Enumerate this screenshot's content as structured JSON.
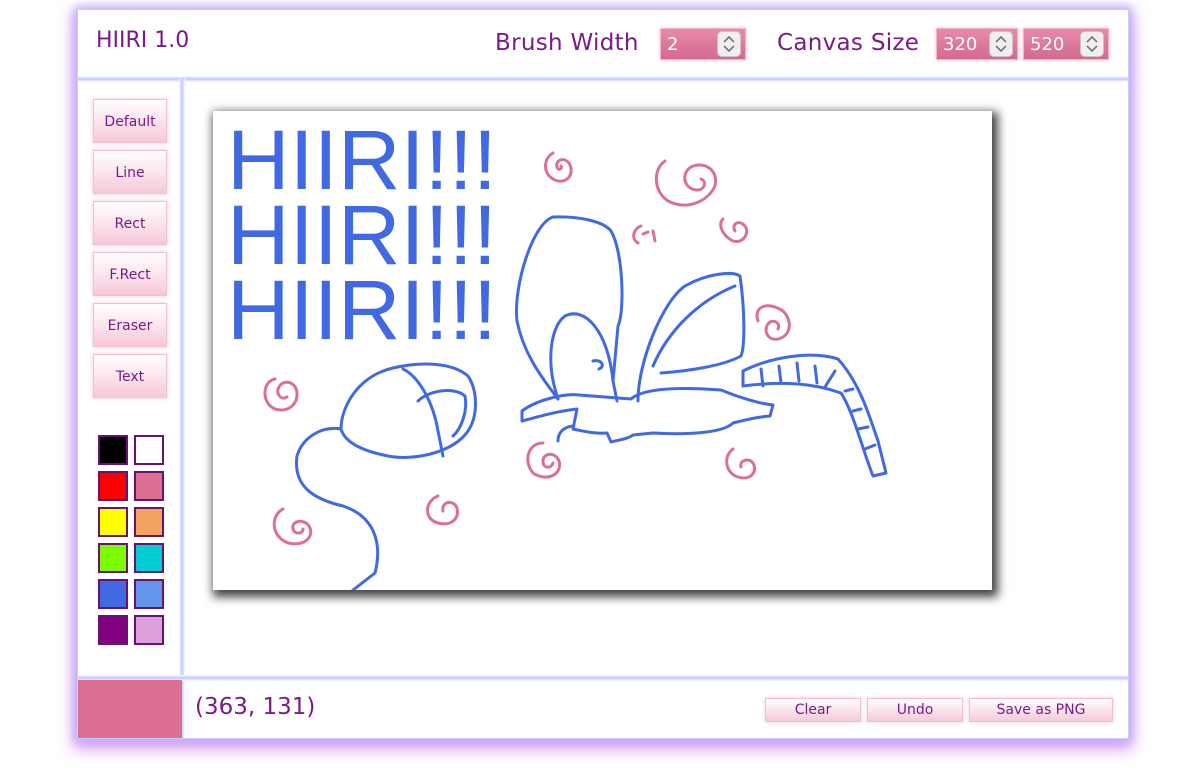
{
  "app": {
    "title": "HIIRI 1.0"
  },
  "toolbar": {
    "brush_width_label": "Brush Width",
    "brush_width_value": "2",
    "canvas_size_label": "Canvas Size",
    "canvas_width_value": "320",
    "canvas_height_value": "520"
  },
  "tools": [
    {
      "label": "Default"
    },
    {
      "label": "Line"
    },
    {
      "label": "Rect"
    },
    {
      "label": "F.Rect"
    },
    {
      "label": "Eraser"
    },
    {
      "label": "Text"
    }
  ],
  "palette": [
    "#000000",
    "#ffffff",
    "#ff0000",
    "#db7093",
    "#ffff00",
    "#f4a460",
    "#7cfc00",
    "#00ced1",
    "#4169e1",
    "#6495ed",
    "#800080",
    "#dda0dd"
  ],
  "current_color": "#db7093",
  "canvas": {
    "text_lines": [
      "HIIRI!!!",
      "HIIRI!!!",
      "HIIRI!!!"
    ],
    "text_color": "#4169e1",
    "stroke_blue": "#4169e1",
    "stroke_pink": "#db7093"
  },
  "status": {
    "coords": "(363, 131)"
  },
  "actions": {
    "clear": "Clear",
    "undo": "Undo",
    "save": "Save as PNG"
  }
}
